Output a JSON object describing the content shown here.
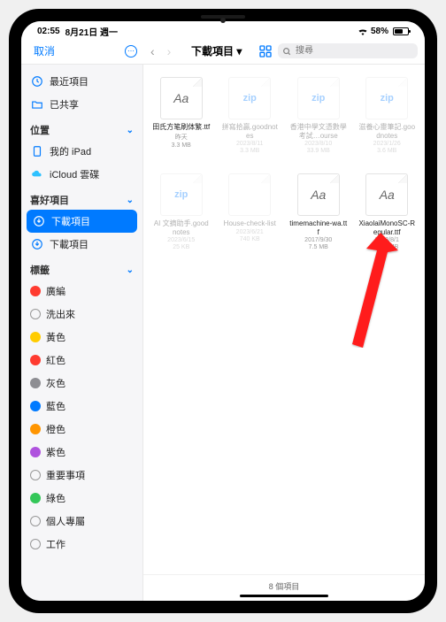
{
  "status": {
    "time": "02:55",
    "date": "8月21日 週一",
    "battery": "58%"
  },
  "toolbar": {
    "cancel": "取消",
    "title": "下載項目 ▾",
    "search_placeholder": "搜尋"
  },
  "sidebar": {
    "recent": {
      "label": "最近項目"
    },
    "shared": {
      "label": "已共享"
    },
    "sections": {
      "locations": "位置",
      "favorites": "喜好項目",
      "tags": "標籤"
    },
    "locations": [
      {
        "label": "我的 iPad"
      },
      {
        "label": "iCloud 雲碟"
      }
    ],
    "favorites": [
      {
        "label": "下載項目",
        "active": true
      },
      {
        "label": "下載項目"
      }
    ],
    "tags": [
      {
        "label": "廣編",
        "color": "#ff3b30"
      },
      {
        "label": "洗出來",
        "color": "hollow"
      },
      {
        "label": "黃色",
        "color": "#ffcc00"
      },
      {
        "label": "紅色",
        "color": "#ff3b30"
      },
      {
        "label": "灰色",
        "color": "#8e8e93"
      },
      {
        "label": "藍色",
        "color": "#007aff"
      },
      {
        "label": "橙色",
        "color": "#ff9500"
      },
      {
        "label": "紫色",
        "color": "#af52de"
      },
      {
        "label": "重要事項",
        "color": "hollow"
      },
      {
        "label": "綠色",
        "color": "#34c759"
      },
      {
        "label": "個人專屬",
        "color": "hollow"
      },
      {
        "label": "工作",
        "color": "hollow"
      }
    ]
  },
  "files": [
    {
      "name": "田氏方笔刷体繁.ttf",
      "date": "昨天",
      "size": "3.3 MB",
      "type": "font",
      "faded": false
    },
    {
      "name": "拼寫拾贏.goodnotes",
      "date": "2023/8/11",
      "size": "3.3 MB",
      "type": "zip",
      "faded": true
    },
    {
      "name": "香港中學文憑數學考試…ourse",
      "date": "2023/8/10",
      "size": "33.9 MB",
      "type": "zip",
      "faded": true
    },
    {
      "name": "滋養心靈筆記.goodnotes",
      "date": "2023/1/26",
      "size": "3.6 MB",
      "type": "zip",
      "faded": true
    },
    {
      "name": "AI 文摘助手.goodnotes",
      "date": "2023/6/15",
      "size": "25 KB",
      "type": "zip",
      "faded": true
    },
    {
      "name": "House-check-list",
      "date": "2023/6/21",
      "size": "740 KB",
      "type": "doc",
      "faded": true
    },
    {
      "name": "timemachine-wa.ttf",
      "date": "2017/9/30",
      "size": "7.5 MB",
      "type": "font",
      "faded": false
    },
    {
      "name": "XiaolaiMonoSC-Regular.ttf",
      "date": "2023/8/1",
      "size": "21.9 MB",
      "type": "font",
      "faded": false
    }
  ],
  "footer": {
    "count": "8 個項目"
  }
}
